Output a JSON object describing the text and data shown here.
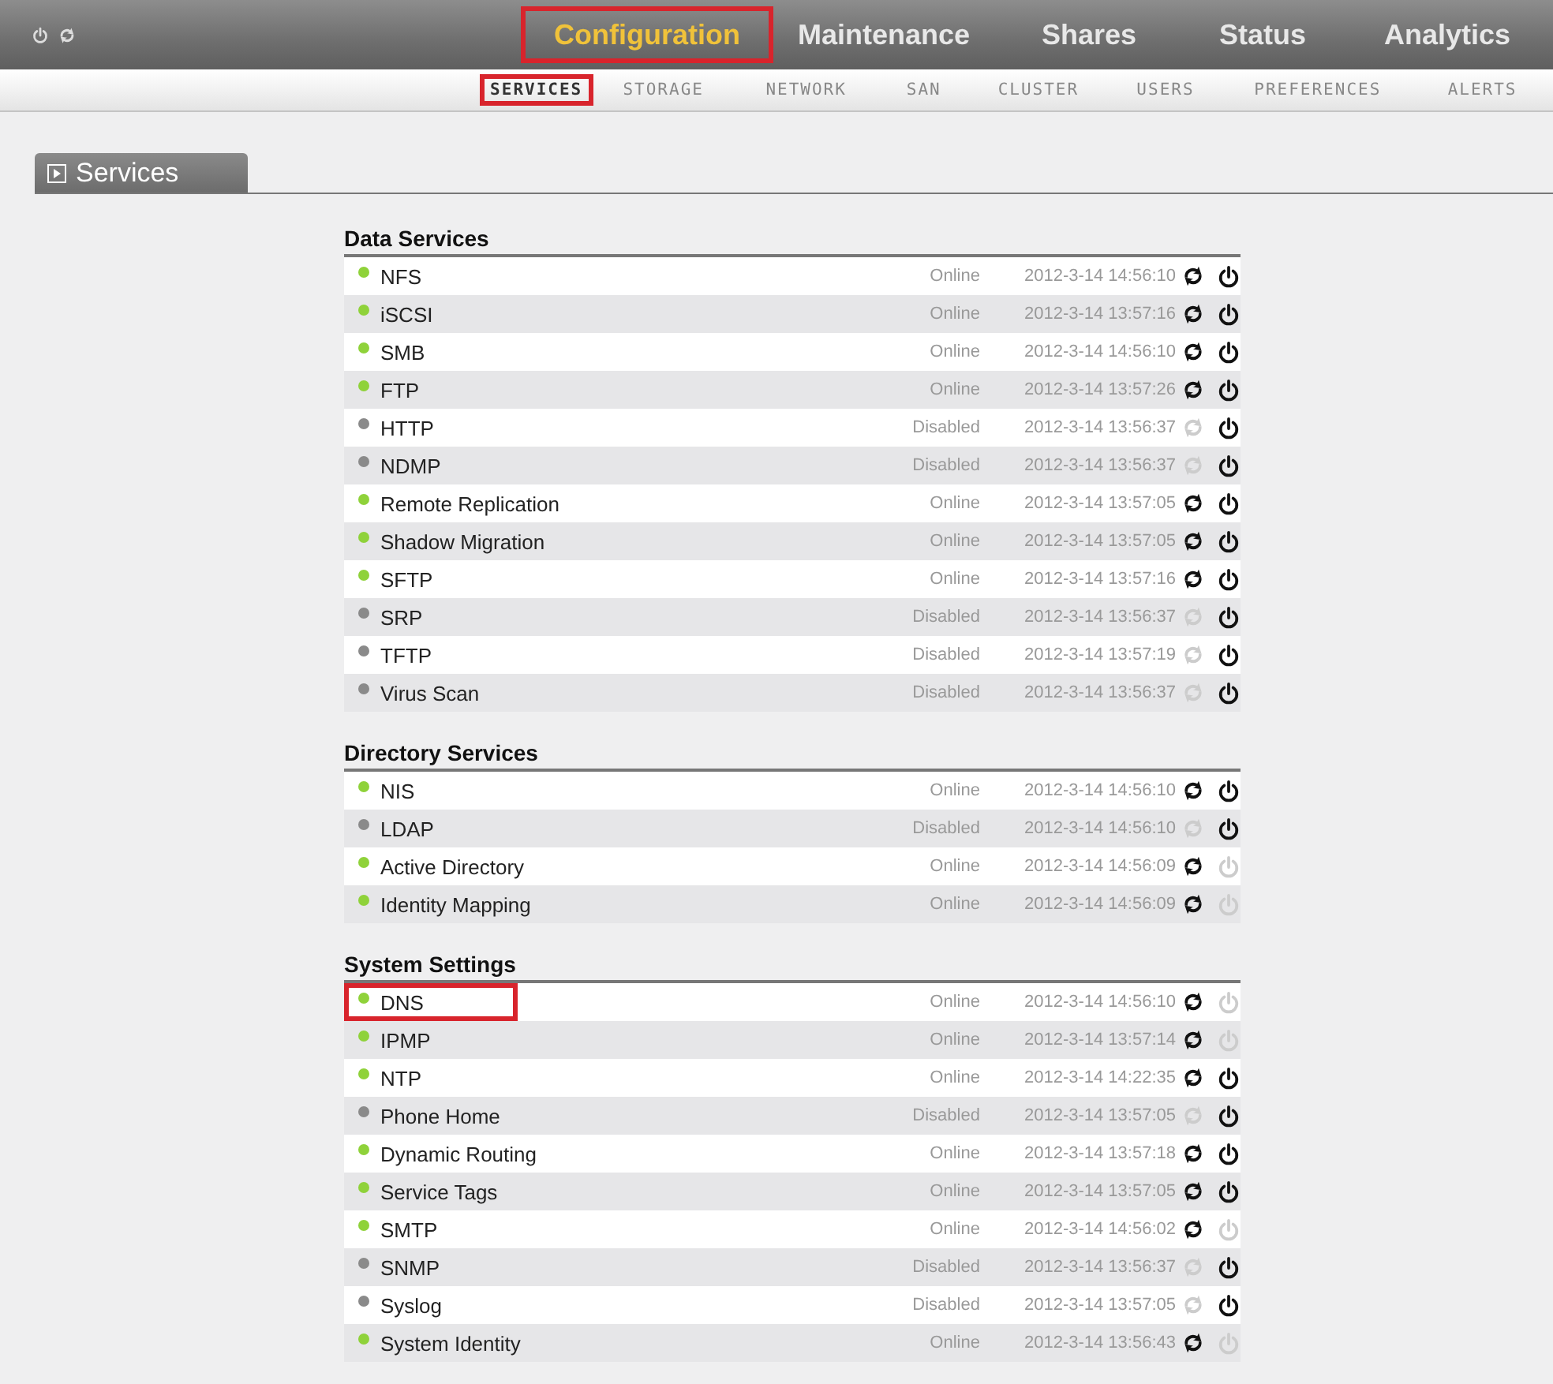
{
  "main_tabs": [
    {
      "label": "Configuration",
      "selected": true,
      "highlighted": true
    },
    {
      "label": "Maintenance",
      "selected": false,
      "highlighted": false
    },
    {
      "label": "Shares",
      "selected": false,
      "highlighted": false
    },
    {
      "label": "Status",
      "selected": false,
      "highlighted": false
    },
    {
      "label": "Analytics",
      "selected": false,
      "highlighted": false
    }
  ],
  "sub_tabs": [
    {
      "label": "SERVICES",
      "selected": true,
      "highlighted": true
    },
    {
      "label": "STORAGE",
      "selected": false,
      "highlighted": false
    },
    {
      "label": "NETWORK",
      "selected": false,
      "highlighted": false
    },
    {
      "label": "SAN",
      "selected": false,
      "highlighted": false
    },
    {
      "label": "CLUSTER",
      "selected": false,
      "highlighted": false
    },
    {
      "label": "USERS",
      "selected": false,
      "highlighted": false
    },
    {
      "label": "PREFERENCES",
      "selected": false,
      "highlighted": false
    },
    {
      "label": "ALERTS",
      "selected": false,
      "highlighted": false
    }
  ],
  "panel_tab": {
    "label": "Services"
  },
  "sections": [
    {
      "title": "Data Services",
      "rows": [
        {
          "name": "NFS",
          "online": true,
          "status": "Online",
          "time": "2012-3-14 14:56:10",
          "restart_enabled": true,
          "power_enabled": true,
          "highlighted": false
        },
        {
          "name": "iSCSI",
          "online": true,
          "status": "Online",
          "time": "2012-3-14 13:57:16",
          "restart_enabled": true,
          "power_enabled": true,
          "highlighted": false
        },
        {
          "name": "SMB",
          "online": true,
          "status": "Online",
          "time": "2012-3-14 14:56:10",
          "restart_enabled": true,
          "power_enabled": true,
          "highlighted": false
        },
        {
          "name": "FTP",
          "online": true,
          "status": "Online",
          "time": "2012-3-14 13:57:26",
          "restart_enabled": true,
          "power_enabled": true,
          "highlighted": false
        },
        {
          "name": "HTTP",
          "online": false,
          "status": "Disabled",
          "time": "2012-3-14 13:56:37",
          "restart_enabled": false,
          "power_enabled": true,
          "highlighted": false
        },
        {
          "name": "NDMP",
          "online": false,
          "status": "Disabled",
          "time": "2012-3-14 13:56:37",
          "restart_enabled": false,
          "power_enabled": true,
          "highlighted": false
        },
        {
          "name": "Remote Replication",
          "online": true,
          "status": "Online",
          "time": "2012-3-14 13:57:05",
          "restart_enabled": true,
          "power_enabled": true,
          "highlighted": false
        },
        {
          "name": "Shadow Migration",
          "online": true,
          "status": "Online",
          "time": "2012-3-14 13:57:05",
          "restart_enabled": true,
          "power_enabled": true,
          "highlighted": false
        },
        {
          "name": "SFTP",
          "online": true,
          "status": "Online",
          "time": "2012-3-14 13:57:16",
          "restart_enabled": true,
          "power_enabled": true,
          "highlighted": false
        },
        {
          "name": "SRP",
          "online": false,
          "status": "Disabled",
          "time": "2012-3-14 13:56:37",
          "restart_enabled": false,
          "power_enabled": true,
          "highlighted": false
        },
        {
          "name": "TFTP",
          "online": false,
          "status": "Disabled",
          "time": "2012-3-14 13:57:19",
          "restart_enabled": false,
          "power_enabled": true,
          "highlighted": false
        },
        {
          "name": "Virus Scan",
          "online": false,
          "status": "Disabled",
          "time": "2012-3-14 13:56:37",
          "restart_enabled": false,
          "power_enabled": true,
          "highlighted": false
        }
      ]
    },
    {
      "title": "Directory Services",
      "rows": [
        {
          "name": "NIS",
          "online": true,
          "status": "Online",
          "time": "2012-3-14 14:56:10",
          "restart_enabled": true,
          "power_enabled": true,
          "highlighted": false
        },
        {
          "name": "LDAP",
          "online": false,
          "status": "Disabled",
          "time": "2012-3-14 14:56:10",
          "restart_enabled": false,
          "power_enabled": true,
          "highlighted": false
        },
        {
          "name": "Active Directory",
          "online": true,
          "status": "Online",
          "time": "2012-3-14 14:56:09",
          "restart_enabled": true,
          "power_enabled": false,
          "highlighted": false
        },
        {
          "name": "Identity Mapping",
          "online": true,
          "status": "Online",
          "time": "2012-3-14 14:56:09",
          "restart_enabled": true,
          "power_enabled": false,
          "highlighted": false
        }
      ]
    },
    {
      "title": "System Settings",
      "rows": [
        {
          "name": "DNS",
          "online": true,
          "status": "Online",
          "time": "2012-3-14 14:56:10",
          "restart_enabled": true,
          "power_enabled": false,
          "highlighted": true
        },
        {
          "name": "IPMP",
          "online": true,
          "status": "Online",
          "time": "2012-3-14 13:57:14",
          "restart_enabled": true,
          "power_enabled": false,
          "highlighted": false
        },
        {
          "name": "NTP",
          "online": true,
          "status": "Online",
          "time": "2012-3-14 14:22:35",
          "restart_enabled": true,
          "power_enabled": true,
          "highlighted": false
        },
        {
          "name": "Phone Home",
          "online": false,
          "status": "Disabled",
          "time": "2012-3-14 13:57:05",
          "restart_enabled": false,
          "power_enabled": true,
          "highlighted": false
        },
        {
          "name": "Dynamic Routing",
          "online": true,
          "status": "Online",
          "time": "2012-3-14 13:57:18",
          "restart_enabled": true,
          "power_enabled": true,
          "highlighted": false
        },
        {
          "name": "Service Tags",
          "online": true,
          "status": "Online",
          "time": "2012-3-14 13:57:05",
          "restart_enabled": true,
          "power_enabled": true,
          "highlighted": false
        },
        {
          "name": "SMTP",
          "online": true,
          "status": "Online",
          "time": "2012-3-14 14:56:02",
          "restart_enabled": true,
          "power_enabled": false,
          "highlighted": false
        },
        {
          "name": "SNMP",
          "online": false,
          "status": "Disabled",
          "time": "2012-3-14 13:56:37",
          "restart_enabled": false,
          "power_enabled": true,
          "highlighted": false
        },
        {
          "name": "Syslog",
          "online": false,
          "status": "Disabled",
          "time": "2012-3-14 13:57:05",
          "restart_enabled": false,
          "power_enabled": true,
          "highlighted": false
        },
        {
          "name": "System Identity",
          "online": true,
          "status": "Online",
          "time": "2012-3-14 13:56:43",
          "restart_enabled": true,
          "power_enabled": false,
          "highlighted": false
        }
      ]
    }
  ]
}
